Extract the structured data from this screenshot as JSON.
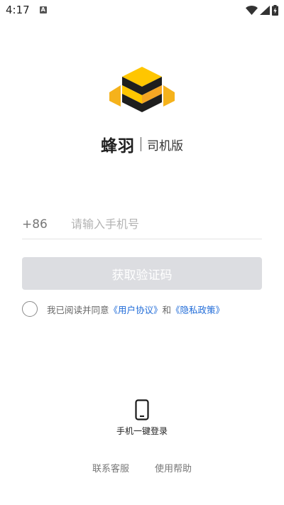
{
  "status_bar": {
    "time": "4:17",
    "notification_icon": "a-badge-icon",
    "wifi_icon": "wifi-icon",
    "signal_icon": "cell-signal-icon",
    "battery_icon": "battery-charging-icon"
  },
  "brand": {
    "name": "蜂羽",
    "subtitle": "司机版",
    "colors": {
      "yellow": "#FFC600",
      "orange": "#F5A623",
      "black": "#1E1E1E"
    }
  },
  "login_form": {
    "country_code": "+86",
    "phone_placeholder": "请输入手机号",
    "phone_value": "",
    "get_code_label": "获取验证码"
  },
  "agreement": {
    "prefix": "我已阅读并同意",
    "user_agreement": "《用户协议》",
    "conjunction": "和",
    "privacy_policy": "《隐私政策》",
    "checked": false
  },
  "one_tap_login": {
    "icon": "phone-icon",
    "label": "手机一键登录"
  },
  "footer": {
    "contact_service": "联系客服",
    "help": "使用帮助"
  },
  "accent_color": "#1f6bd8"
}
